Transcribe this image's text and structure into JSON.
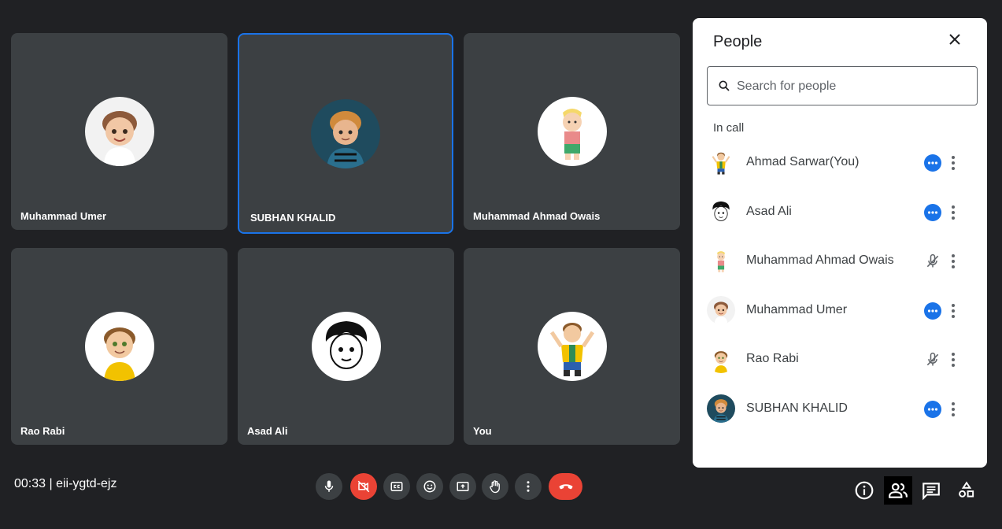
{
  "tiles": [
    {
      "name": "Muhammad Umer"
    },
    {
      "name": "SUBHAN KHALID"
    },
    {
      "name": "Muhammad Ahmad Owais"
    },
    {
      "name": "Rao Rabi"
    },
    {
      "name": "Asad Ali"
    },
    {
      "name": "You"
    }
  ],
  "meeting": {
    "info": "00:33 | eii-ygtd-ejz"
  },
  "controls": [
    "mic-icon",
    "camera-off-icon",
    "captions-icon",
    "emoji-icon",
    "present-icon",
    "raise-hand-icon",
    "more-options-icon",
    "hangup-icon"
  ],
  "right_buttons": [
    "info-icon",
    "people-icon",
    "chat-icon",
    "activities-icon"
  ],
  "panel": {
    "title": "People",
    "search_placeholder": "Search for people",
    "section_label": "In call",
    "people": [
      {
        "name": "Ahmad Sarwar(You)",
        "status": "speaking-dots-icon"
      },
      {
        "name": "Asad Ali",
        "status": "speaking-dots-icon"
      },
      {
        "name": "Muhammad Ahmad Owais",
        "status": "mic-off-icon"
      },
      {
        "name": "Muhammad Umer",
        "status": "speaking-dots-icon"
      },
      {
        "name": "Rao Rabi",
        "status": "mic-off-icon"
      },
      {
        "name": "SUBHAN KHALID",
        "status": "speaking-dots-icon"
      }
    ]
  },
  "colors": {
    "background": "#202124",
    "tile": "#3c4043",
    "accent": "#1a73e8",
    "danger": "#ea4335"
  }
}
